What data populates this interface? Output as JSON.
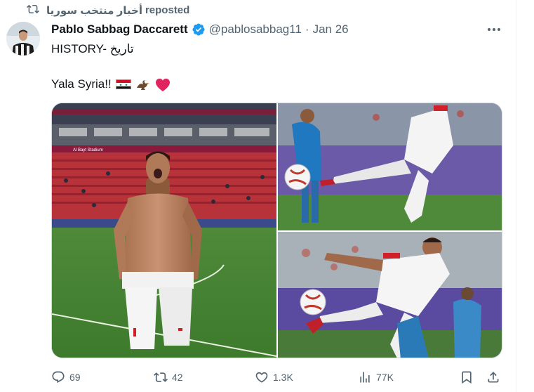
{
  "repost": {
    "account": "أخبار منتخب سوريا",
    "suffix": "reposted"
  },
  "post": {
    "author_name": "Pablo Sabbag Daccarett",
    "handle": "@pablosabbag11",
    "separator": "·",
    "date": "Jan 26",
    "line1": "HISTORY- تاريخ",
    "line2": "Yala Syria!!",
    "emojis": [
      "syria-flag-icon",
      "eagle-icon",
      "red-heart-icon"
    ]
  },
  "media": {
    "photos": [
      "player-celebration-photo",
      "player-kick-photo",
      "player-volley-photo"
    ],
    "stadium_banner": "Al Bayt Stadium"
  },
  "stats": {
    "replies": "69",
    "reposts": "42",
    "likes": "1.3K",
    "views": "77K"
  },
  "colors": {
    "text": "#0f1419",
    "secondary": "#536471",
    "verified": "#1d9bf0",
    "heart": "#e0245e"
  }
}
